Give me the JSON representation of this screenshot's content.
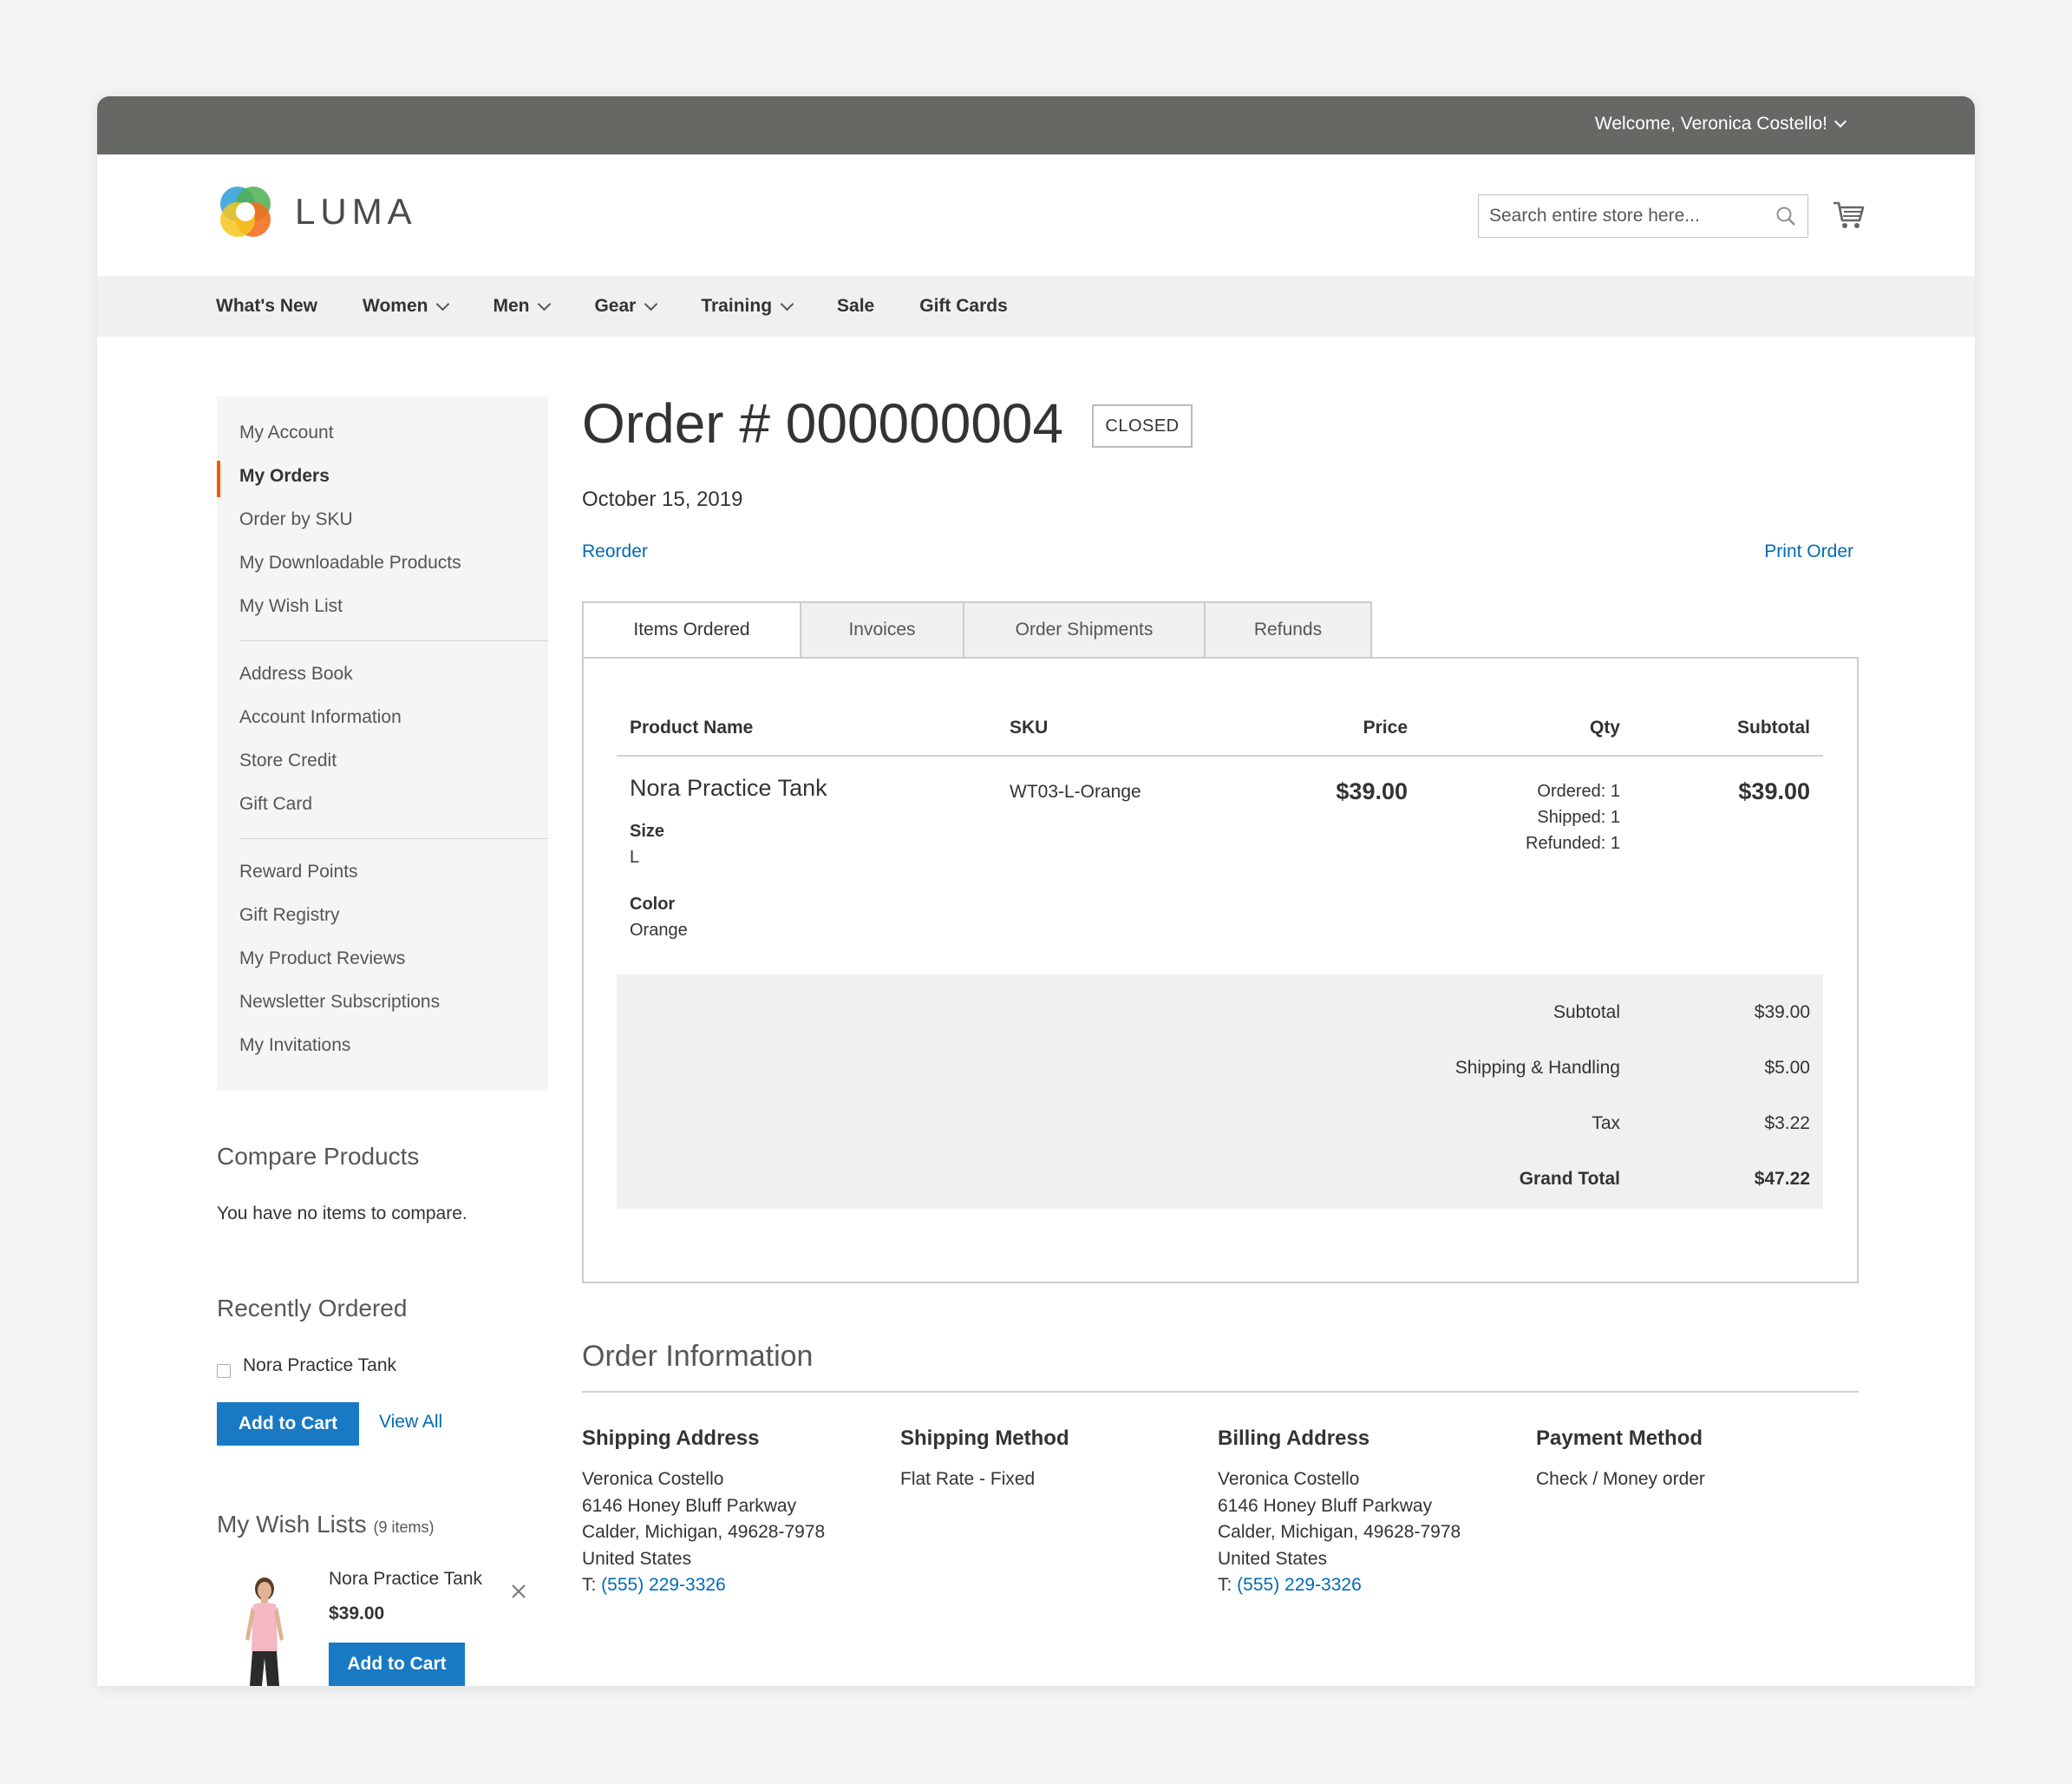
{
  "topbar": {
    "welcome": "Welcome, Veronica Costello!"
  },
  "header": {
    "logo_text": "LUMA",
    "search_placeholder": "Search entire store here..."
  },
  "nav": [
    {
      "label": "What's New",
      "has_dropdown": false
    },
    {
      "label": "Women",
      "has_dropdown": true
    },
    {
      "label": "Men",
      "has_dropdown": true
    },
    {
      "label": "Gear",
      "has_dropdown": true
    },
    {
      "label": "Training",
      "has_dropdown": true
    },
    {
      "label": "Sale",
      "has_dropdown": false
    },
    {
      "label": "Gift Cards",
      "has_dropdown": false
    }
  ],
  "sidebar": {
    "group1": [
      "My Account",
      "My Orders",
      "Order by SKU",
      "My Downloadable Products",
      "My Wish List"
    ],
    "group2": [
      "Address Book",
      "Account Information",
      "Store Credit",
      "Gift Card"
    ],
    "group3": [
      "Reward Points",
      "Gift Registry",
      "My Product Reviews",
      "Newsletter Subscriptions",
      "My Invitations"
    ],
    "active": "My Orders"
  },
  "compare": {
    "title": "Compare Products",
    "empty_text": "You have no items to compare."
  },
  "recently_ordered": {
    "title": "Recently Ordered",
    "item": "Nora Practice Tank",
    "add_to_cart": "Add to Cart",
    "view_all": "View All"
  },
  "wishlist": {
    "title": "My Wish Lists",
    "count": "(9 items)",
    "item_name": "Nora Practice Tank",
    "item_price": "$39.00",
    "add_to_cart": "Add to Cart"
  },
  "order": {
    "title": "Order # 000000004",
    "status": "CLOSED",
    "date": "October 15, 2019",
    "reorder": "Reorder",
    "print": "Print Order"
  },
  "tabs": [
    "Items Ordered",
    "Invoices",
    "Order Shipments",
    "Refunds"
  ],
  "items_table": {
    "headers": {
      "name": "Product Name",
      "sku": "SKU",
      "price": "Price",
      "qty": "Qty",
      "subtotal": "Subtotal"
    },
    "row": {
      "name": "Nora Practice Tank",
      "size_label": "Size",
      "size_value": "L",
      "color_label": "Color",
      "color_value": "Orange",
      "sku": "WT03-L-Orange",
      "price": "$39.00",
      "qty_ordered": "Ordered: 1",
      "qty_shipped": "Shipped: 1",
      "qty_refunded": "Refunded: 1",
      "subtotal": "$39.00"
    },
    "totals": [
      {
        "label": "Subtotal",
        "value": "$39.00"
      },
      {
        "label": "Shipping & Handling",
        "value": "$5.00"
      },
      {
        "label": "Tax",
        "value": "$3.22"
      },
      {
        "label": "Grand Total",
        "value": "$47.22"
      }
    ]
  },
  "order_info": {
    "title": "Order Information",
    "shipping_address": {
      "heading": "Shipping Address",
      "lines": [
        "Veronica Costello",
        "6146 Honey Bluff Parkway",
        "Calder, Michigan, 49628-7978",
        "United States"
      ],
      "tel_prefix": "T: ",
      "tel": "(555) 229-3326"
    },
    "shipping_method": {
      "heading": "Shipping Method",
      "value": "Flat Rate - Fixed"
    },
    "billing_address": {
      "heading": "Billing Address",
      "lines": [
        "Veronica Costello",
        "6146 Honey Bluff Parkway",
        "Calder, Michigan, 49628-7978",
        "United States"
      ],
      "tel_prefix": "T: ",
      "tel": "(555) 229-3326"
    },
    "payment_method": {
      "heading": "Payment Method",
      "value": "Check / Money order"
    }
  },
  "colors": {
    "topbar": "#666864",
    "link": "#006bb4",
    "button": "#1979c3",
    "active_accent": "#ff5501",
    "panel_bg": "#f0f0f0"
  },
  "icons": [
    "chevron-down-icon",
    "search-icon",
    "cart-icon",
    "close-icon",
    "luma-logo-icon"
  ]
}
